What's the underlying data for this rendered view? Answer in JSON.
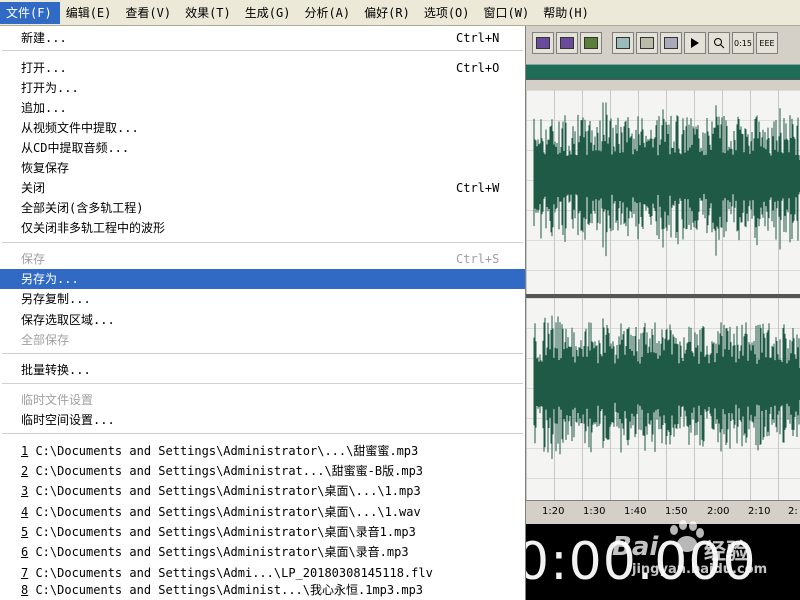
{
  "menubar": {
    "items": [
      {
        "label": "文件(F)",
        "active": true
      },
      {
        "label": "编辑(E)"
      },
      {
        "label": "查看(V)"
      },
      {
        "label": "效果(T)"
      },
      {
        "label": "生成(G)"
      },
      {
        "label": "分析(A)"
      },
      {
        "label": "偏好(R)"
      },
      {
        "label": "选项(O)"
      },
      {
        "label": "窗口(W)"
      },
      {
        "label": "帮助(H)"
      }
    ]
  },
  "file_menu": {
    "new": {
      "label": "新建...",
      "shortcut": "Ctrl+N"
    },
    "open": {
      "label": "打开...",
      "shortcut": "Ctrl+O"
    },
    "open_as": {
      "label": "打开为..."
    },
    "append": {
      "label": "追加..."
    },
    "extract_video": {
      "label": "从视频文件中提取..."
    },
    "extract_cd": {
      "label": "从CD中提取音频..."
    },
    "revert": {
      "label": "恢复保存"
    },
    "close": {
      "label": "关闭",
      "shortcut": "Ctrl+W"
    },
    "close_all": {
      "label": "全部关闭(含多轨工程)"
    },
    "close_non_multitrack": {
      "label": "仅关闭非多轨工程中的波形"
    },
    "save": {
      "label": "保存",
      "shortcut": "Ctrl+S",
      "disabled": true
    },
    "save_as": {
      "label": "另存为...",
      "highlighted": true
    },
    "save_copy": {
      "label": "另存复制..."
    },
    "save_selection": {
      "label": "保存选取区域..."
    },
    "save_all": {
      "label": "全部保存",
      "disabled": true
    },
    "batch": {
      "label": "批量转换..."
    },
    "temp_files": {
      "label": "临时文件设置",
      "disabled": true
    },
    "temp_space": {
      "label": "临时空间设置..."
    },
    "recent": [
      {
        "num": "1",
        "path": " C:\\Documents and Settings\\Administrator\\...\\甜蜜蜜.mp3"
      },
      {
        "num": "2",
        "path": " C:\\Documents and Settings\\Administrat...\\甜蜜蜜-B版.mp3"
      },
      {
        "num": "3",
        "path": " C:\\Documents and Settings\\Administrator\\桌面\\...\\1.mp3"
      },
      {
        "num": "4",
        "path": " C:\\Documents and Settings\\Administrator\\桌面\\...\\1.wav"
      },
      {
        "num": "5",
        "path": " C:\\Documents and Settings\\Administrator\\桌面\\录音1.mp3"
      },
      {
        "num": "6",
        "path": " C:\\Documents and Settings\\Administrator\\桌面\\录音.mp3"
      },
      {
        "num": "7",
        "path": " C:\\Documents and Settings\\Admi...\\LP_20180308145118.flv"
      },
      {
        "num": "8",
        "path": " C:\\Documents and Settings\\Administ...\\我心永恒.1mp3.mp3"
      }
    ]
  },
  "toolbar": {
    "icons": [
      "multitrack-view-icon",
      "edit-view-icon",
      "cd-view-icon",
      "view-1-icon",
      "view-2-icon",
      "view-3-icon",
      "play-icon",
      "zoom-icon"
    ],
    "time_label": "0:15",
    "eee_label": "EEE"
  },
  "timeline": {
    "ticks": [
      "1:20",
      "1:30",
      "1:40",
      "1:50",
      "2:00",
      "2:10",
      "2:"
    ]
  },
  "time_display": {
    "value": "0:00.000"
  },
  "colors": {
    "menu_highlight": "#316ac5",
    "waveform": "#1e5a46",
    "time_display_bg": "#000000"
  },
  "watermark": {
    "brand": "Bai",
    "cn": "经验",
    "url": "jingyan.baidu.com"
  }
}
